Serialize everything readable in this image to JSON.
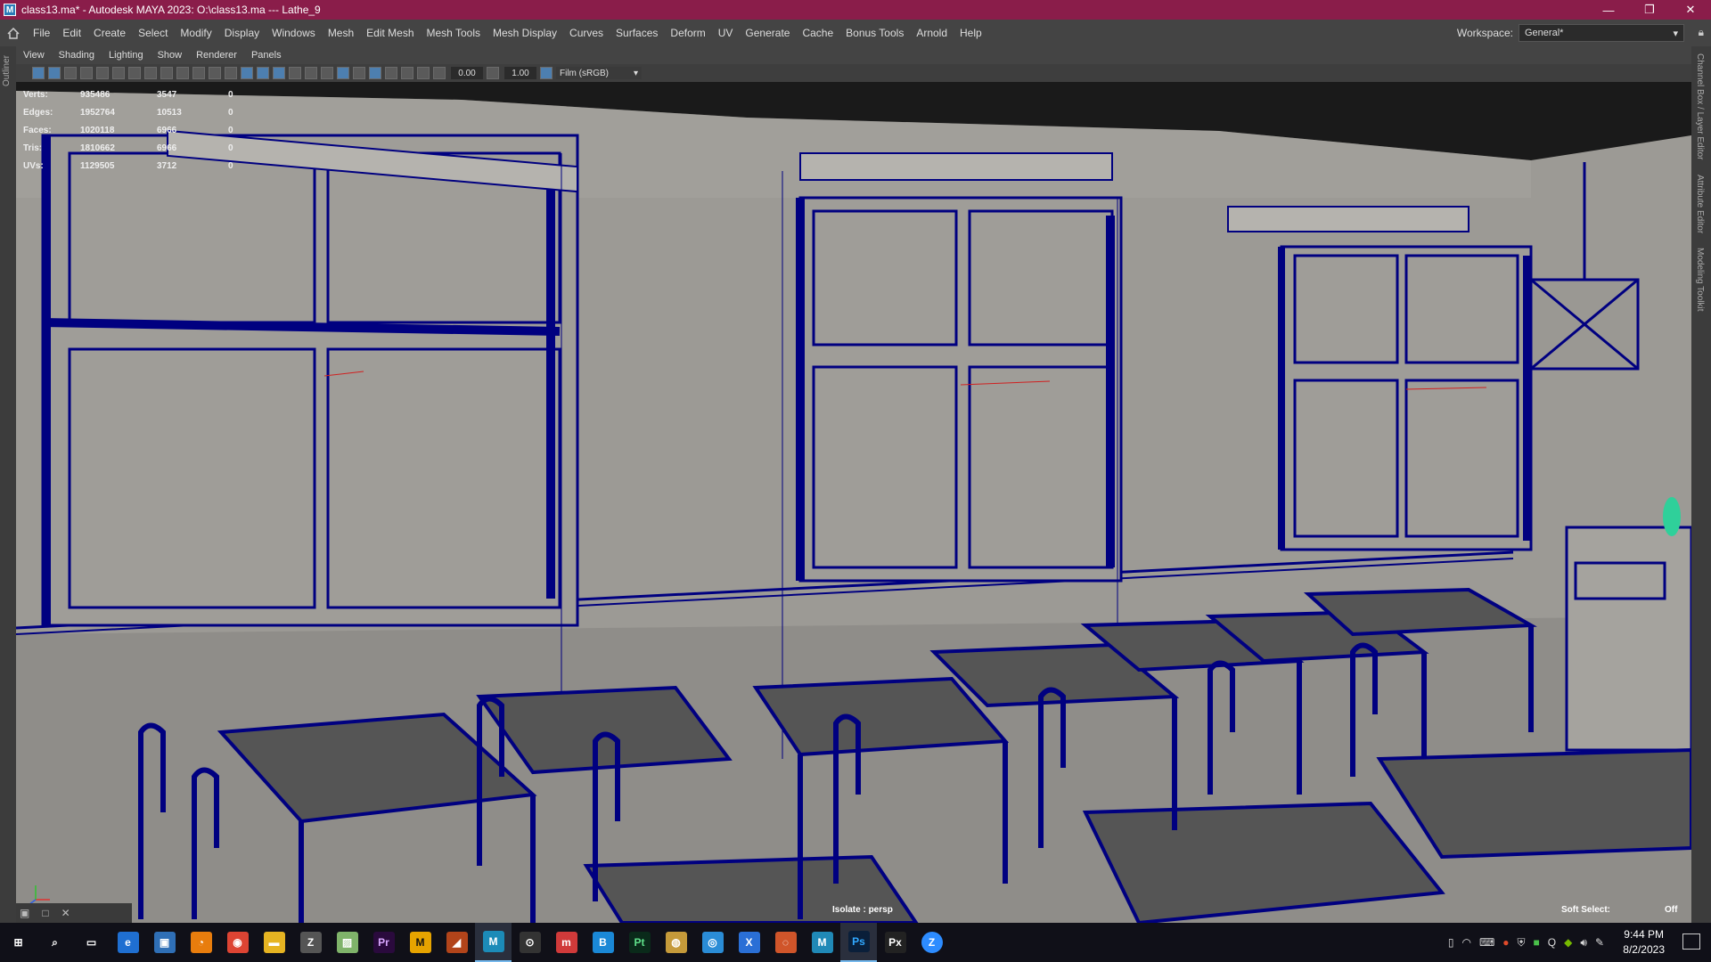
{
  "window": {
    "title": "class13.ma* - Autodesk MAYA 2023: O:\\class13.ma   ---   Lathe_9",
    "app_icon": "M",
    "controls": [
      "—",
      "❐",
      "✕"
    ]
  },
  "menu": {
    "items": [
      "File",
      "Edit",
      "Create",
      "Select",
      "Modify",
      "Display",
      "Windows",
      "Mesh",
      "Edit Mesh",
      "Mesh Tools",
      "Mesh Display",
      "Curves",
      "Surfaces",
      "Deform",
      "UV",
      "Generate",
      "Cache",
      "Bonus Tools",
      "Arnold",
      "Help"
    ],
    "workspace_label": "Workspace:",
    "workspace_value": "General*"
  },
  "side": {
    "outliner": "Outliner",
    "right_tabs": [
      "Channel Box / Layer Editor",
      "Attribute Editor",
      "Modeling Toolkit"
    ]
  },
  "panel_menu": [
    "View",
    "Shading",
    "Lighting",
    "Show",
    "Renderer",
    "Panels"
  ],
  "view_toolbar": {
    "exposure": "0.00",
    "gamma": "1.00",
    "color_space": "Film (sRGB)"
  },
  "hud": {
    "rows": [
      {
        "label": "Verts:",
        "total": "935486",
        "selected": "3547",
        "comp": "0"
      },
      {
        "label": "Edges:",
        "total": "1952764",
        "selected": "10513",
        "comp": "0"
      },
      {
        "label": "Faces:",
        "total": "1020118",
        "selected": "6966",
        "comp": "0"
      },
      {
        "label": "Tris:",
        "total": "1810662",
        "selected": "6966",
        "comp": "0"
      },
      {
        "label": "UVs:",
        "total": "1129505",
        "selected": "3712",
        "comp": "0"
      }
    ],
    "isolate": "Isolate : persp",
    "soft_select_label": "Soft Select:",
    "soft_select_value": "Off"
  },
  "taskbar": {
    "time": "9:44 PM",
    "date": "8/2/2023",
    "apps": [
      {
        "name": "start",
        "glyph": "⊞",
        "color": "#101018"
      },
      {
        "name": "search",
        "glyph": "⌕",
        "color": "#101018"
      },
      {
        "name": "taskview",
        "glyph": "▭",
        "color": "#101018"
      },
      {
        "name": "edge",
        "glyph": "e",
        "color": "#1f6fd1"
      },
      {
        "name": "store",
        "glyph": "▣",
        "color": "#2f6fb6"
      },
      {
        "name": "blender",
        "glyph": "◔",
        "color": "#e87d0d"
      },
      {
        "name": "chrome",
        "glyph": "◉",
        "color": "#dd4433"
      },
      {
        "name": "explorer",
        "glyph": "▬",
        "color": "#e6b422"
      },
      {
        "name": "zbrush",
        "glyph": "Z",
        "color": "#555555"
      },
      {
        "name": "image-viewer",
        "glyph": "▨",
        "color": "#7fb36a"
      },
      {
        "name": "premiere",
        "glyph": "Pr",
        "color": "#2a0a3d"
      },
      {
        "name": "marmoset",
        "glyph": "M",
        "color": "#e6a300"
      },
      {
        "name": "substance-painter",
        "glyph": "◢",
        "color": "#b2441a"
      },
      {
        "name": "maya",
        "glyph": "M",
        "color": "#1c8bb8"
      },
      {
        "name": "search-tool",
        "glyph": "⊙",
        "color": "#333333"
      },
      {
        "name": "mudbox",
        "glyph": "m",
        "color": "#d03a3a"
      },
      {
        "name": "substance-b",
        "glyph": "B",
        "color": "#1a88d6"
      },
      {
        "name": "pt",
        "glyph": "Pt",
        "color": "#0a2a1a"
      },
      {
        "name": "world",
        "glyph": "◍",
        "color": "#c59a3a"
      },
      {
        "name": "refresh",
        "glyph": "◎",
        "color": "#2a8cd6"
      },
      {
        "name": "x-app",
        "glyph": "X",
        "color": "#2a6fd6"
      },
      {
        "name": "rizom",
        "glyph": "◌",
        "color": "#d0552a"
      },
      {
        "name": "maya2",
        "glyph": "M",
        "color": "#2089b7"
      },
      {
        "name": "photoshop",
        "glyph": "Ps",
        "color": "#0a1f3a"
      },
      {
        "name": "px",
        "glyph": "Px",
        "color": "#222222"
      },
      {
        "name": "zoom",
        "glyph": "Z",
        "color": "#2d8cff"
      }
    ]
  }
}
